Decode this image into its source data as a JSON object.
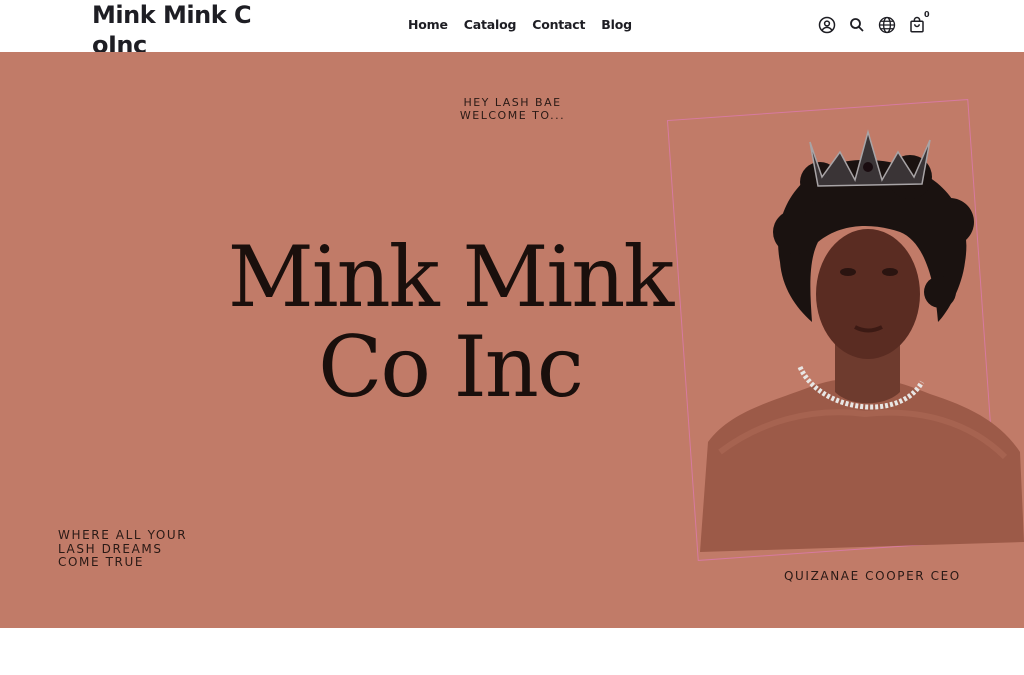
{
  "header": {
    "logo": "Mink Mink CoInc",
    "nav": [
      "Home",
      "Catalog",
      "Contact",
      "Blog"
    ],
    "icons": [
      "account-icon",
      "search-icon",
      "globe-icon",
      "cart-icon"
    ],
    "cart_count": "0"
  },
  "hero": {
    "greeting_line1": "HEY LASH BAE",
    "greeting_line2": "WELCOME TO...",
    "title_line1": "Mink Mink",
    "title_line2": "Co Inc",
    "tagline": "WHERE ALL YOUR LASH DREAMS COME TRUE",
    "ceo": "QUIZANAE COOPER CEO",
    "background_color": "#c17b68",
    "frame_color": "#d77aa0"
  }
}
